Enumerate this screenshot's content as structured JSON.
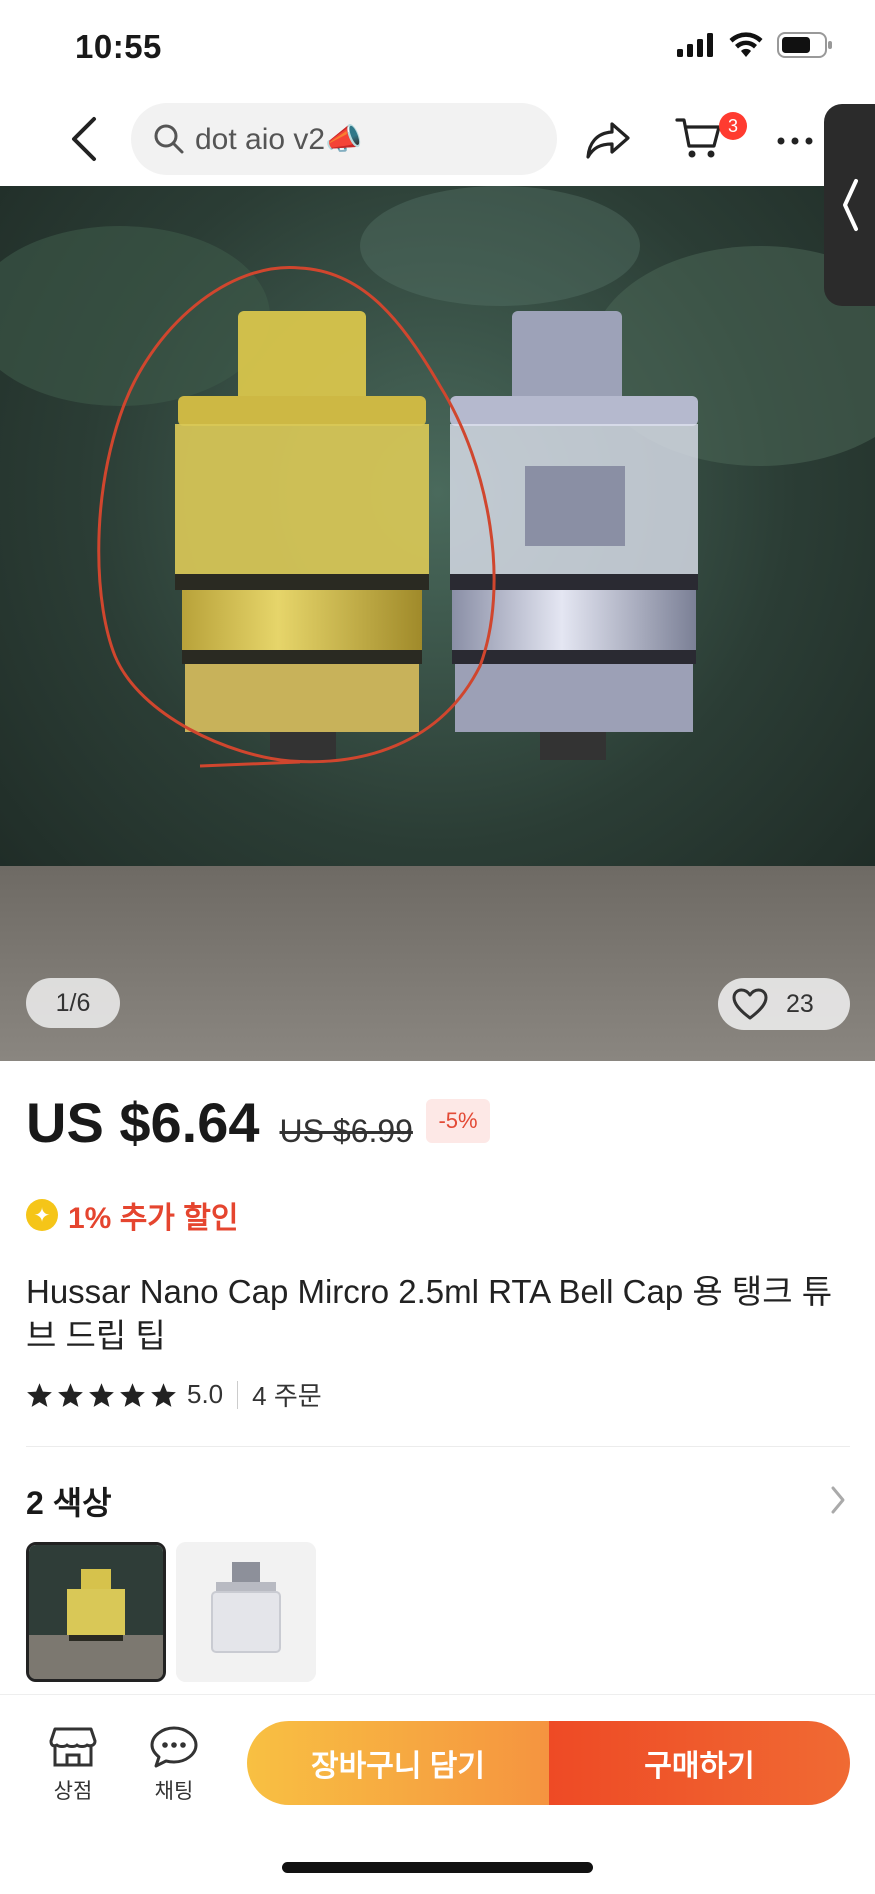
{
  "status_bar": {
    "time": "10:55"
  },
  "header": {
    "search_text": "dot aio v2📣",
    "cart_count": "3"
  },
  "image": {
    "counter": "1/6",
    "wishlist_count": "23"
  },
  "price": {
    "current": "US $6.64",
    "original": "US $6.99",
    "discount": "-5%",
    "coin_discount": "1% 추가 할인"
  },
  "product": {
    "title": "Hussar Nano Cap Mircro 2.5ml RTA Bell Cap 용 탱크 튜브 드립 팁",
    "rating": "5.0",
    "orders": "4 주문"
  },
  "colors": {
    "header": "2 색상"
  },
  "bottom_bar": {
    "store_label": "상점",
    "chat_label": "채팅",
    "add_to_cart": "장바구니 담기",
    "buy_now": "구매하기"
  },
  "colors_theme": {
    "accent": "#e5452f",
    "buy": "#ee4a25",
    "cart": "#f8c042"
  }
}
